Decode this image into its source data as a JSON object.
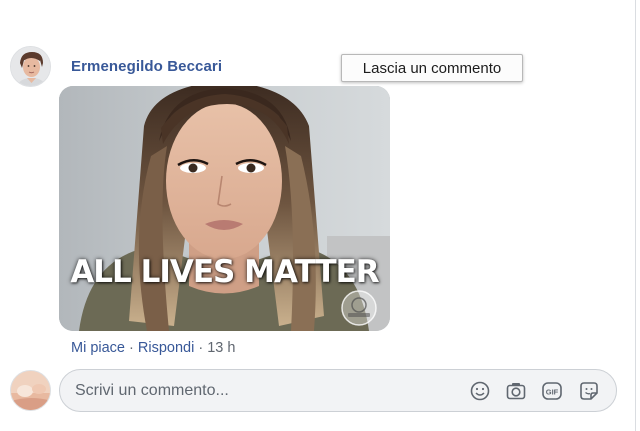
{
  "comment": {
    "author_name": "Ermenegildo Beccari",
    "image_overlay_text": "ALL LIVES MATTER",
    "actions": {
      "like": "Mi piace",
      "reply": "Rispondi",
      "separator": "·",
      "timestamp": "13 h"
    }
  },
  "tooltip": {
    "text": "Lascia un commento"
  },
  "composer": {
    "placeholder": "Scrivi un commento...",
    "icons": [
      "emoji-icon",
      "camera-icon",
      "gif-icon",
      "sticker-icon"
    ],
    "gif_label": "GIF"
  },
  "colors": {
    "link": "#385898",
    "meta": "#606770",
    "composer_bg": "#f2f3f5",
    "composer_border": "#ccd0d5"
  }
}
